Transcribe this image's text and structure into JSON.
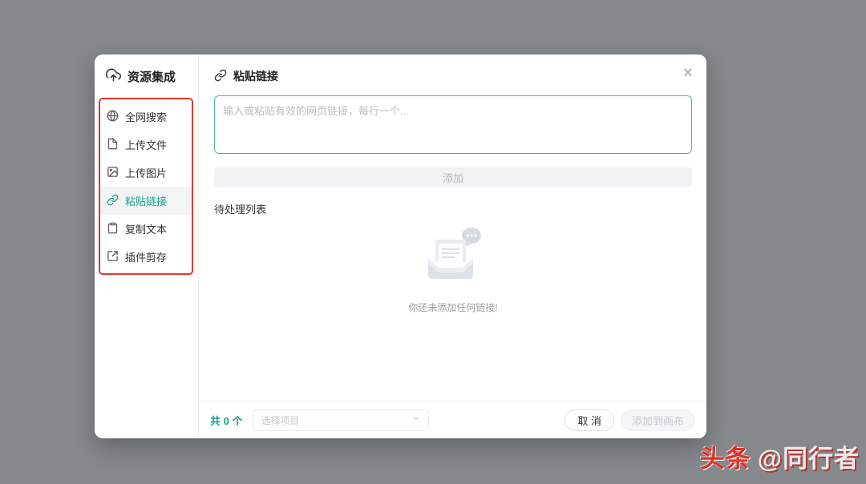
{
  "colors": {
    "accent_teal": "#17a08c",
    "annotation_red": "#e0392b",
    "backdrop_gray": "#86898c",
    "textarea_border_teal": "#55b3a6",
    "watermark_red": "#e72f24"
  },
  "modal": {
    "close_glyph": "✕",
    "sidebar": {
      "title": "资源集成",
      "items": [
        {
          "label": "全网搜索",
          "icon": "globe-icon"
        },
        {
          "label": "上传文件",
          "icon": "file-icon"
        },
        {
          "label": "上传图片",
          "icon": "image-icon"
        },
        {
          "label": "粘贴链接",
          "icon": "link-icon",
          "selected": true
        },
        {
          "label": "复制文本",
          "icon": "clipboard-icon"
        },
        {
          "label": "插件剪存",
          "icon": "clip-icon"
        }
      ]
    },
    "main": {
      "title": "粘贴链接",
      "input_value": "",
      "input_placeholder": "输入或粘贴有效的网页链接，每行一个...",
      "add_button_label": "添加",
      "pending_list_label": "待处理列表",
      "empty_state_text": "你还未添加任何链接!",
      "footer": {
        "count_text": "共 0 个",
        "project_select_placeholder": "选择项目",
        "cancel_button_label": "取 消",
        "submit_button_label": "添加到画布"
      }
    }
  },
  "watermark": {
    "brand": "头条",
    "handle": "@同行者"
  }
}
